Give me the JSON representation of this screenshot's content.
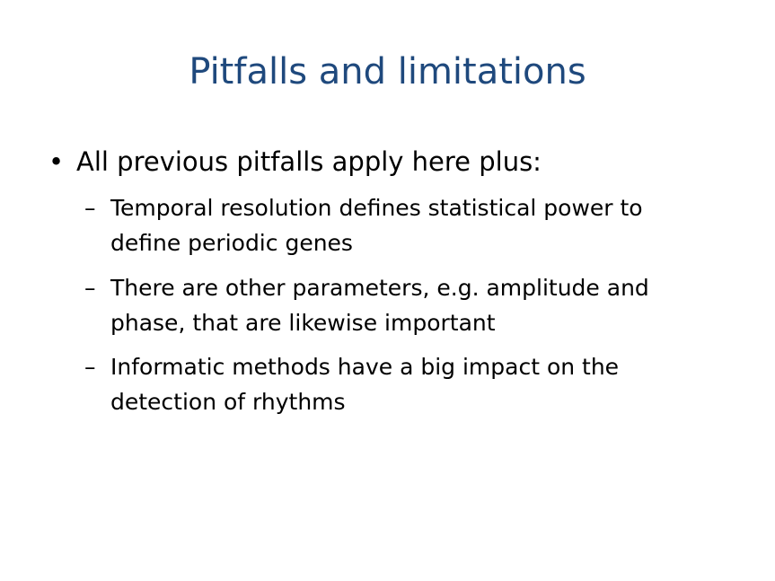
{
  "slide": {
    "title": "Pitfalls and limitations",
    "title_color": "#1F497D",
    "bullet_marker": "•",
    "bullet_text": "All previous pitfalls apply here plus:",
    "sub_marker": "–",
    "sub_items": [
      {
        "line1": "Temporal resolution defines statistical power to",
        "line2": "define periodic genes"
      },
      {
        "line1": "There are other parameters, e.g. amplitude and",
        "line2": "phase, that are likewise important"
      },
      {
        "line1": "Informatic methods have a big impact on the",
        "line2": "detection of rhythms"
      }
    ]
  }
}
